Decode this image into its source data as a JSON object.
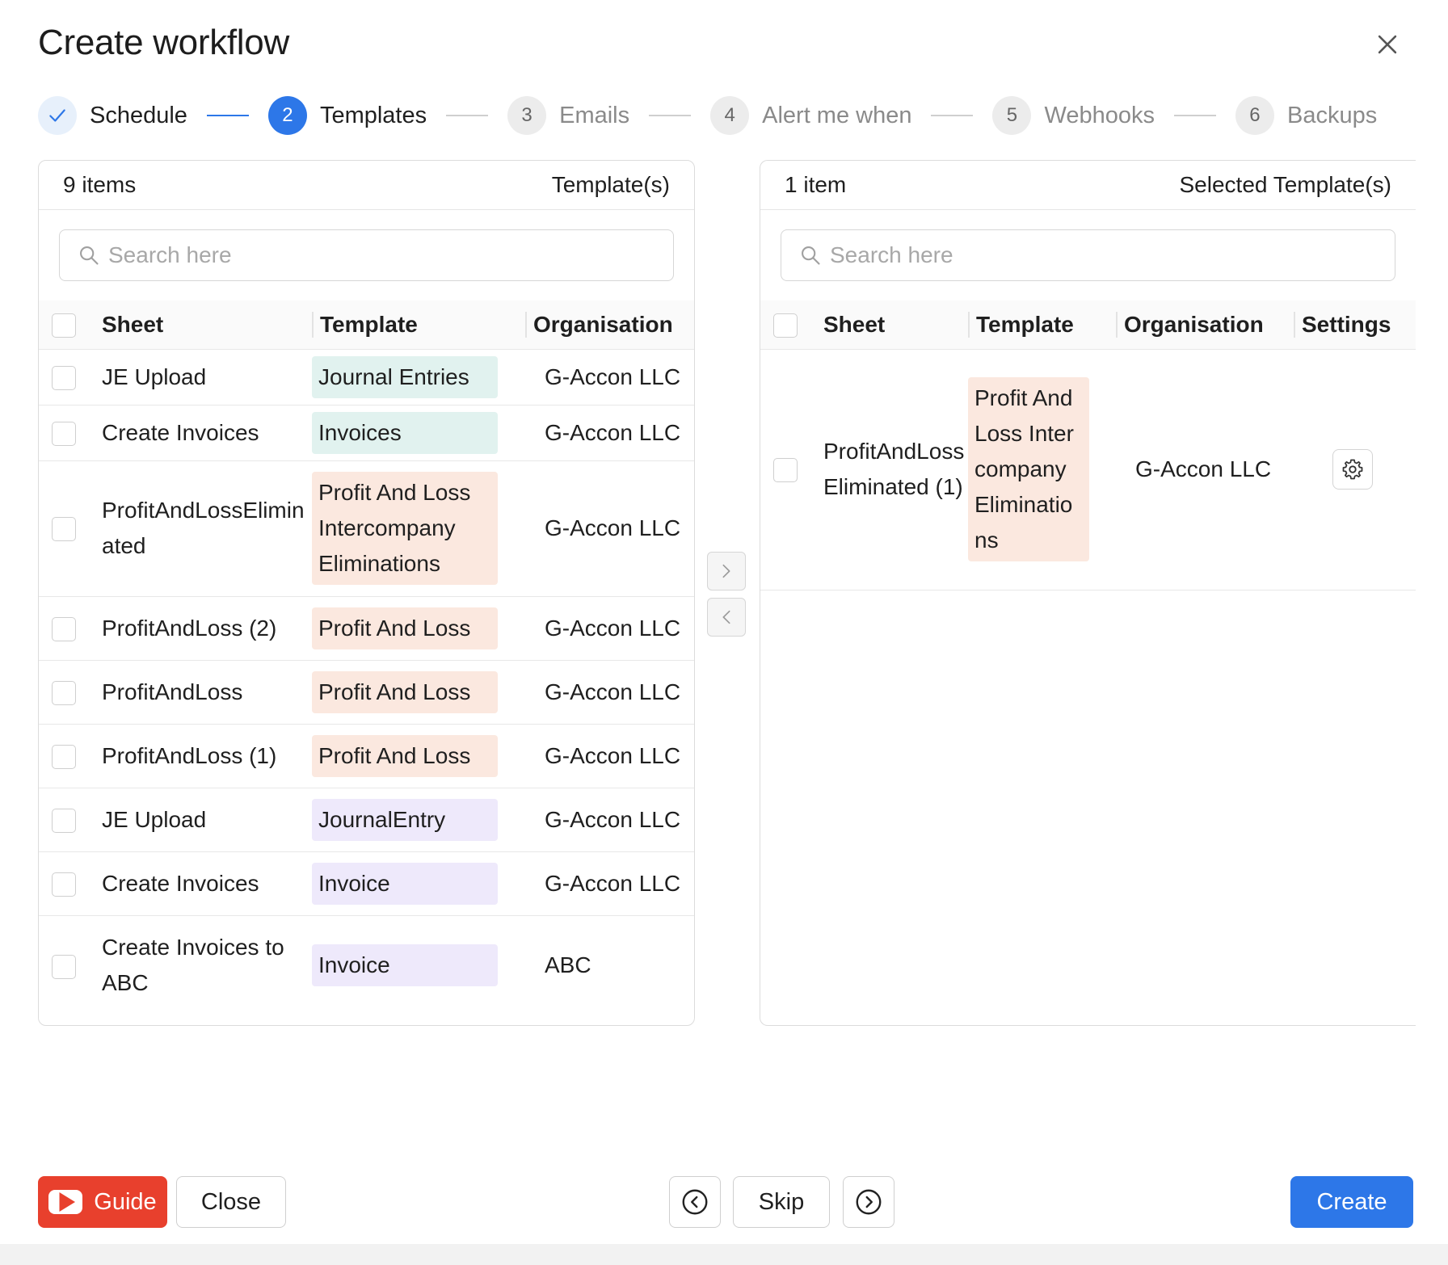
{
  "dialog": {
    "title": "Create workflow"
  },
  "stepper": [
    {
      "number": "",
      "label": "Schedule",
      "state": "done"
    },
    {
      "number": "2",
      "label": "Templates",
      "state": "active"
    },
    {
      "number": "3",
      "label": "Emails",
      "state": "pending"
    },
    {
      "number": "4",
      "label": "Alert me when",
      "state": "pending"
    },
    {
      "number": "5",
      "label": "Webhooks",
      "state": "pending"
    },
    {
      "number": "6",
      "label": "Backups",
      "state": "pending"
    }
  ],
  "left_panel": {
    "count": "9 items",
    "title": "Template(s)",
    "search_placeholder": "Search here",
    "columns": {
      "sheet": "Sheet",
      "template": "Template",
      "organisation": "Organisation"
    },
    "rows": [
      {
        "sheet": "JE Upload",
        "template": "Journal Entries",
        "template_color": "teal",
        "organisation": "G-Accon LLC"
      },
      {
        "sheet": "Create Invoices",
        "template": "Invoices",
        "template_color": "teal",
        "organisation": "G-Accon LLC"
      },
      {
        "sheet": "ProfitAndLossEliminated",
        "template": "Profit And Loss Intercompany Eliminations",
        "template_color": "peach",
        "organisation": "G-Accon LLC"
      },
      {
        "sheet": "ProfitAndLoss (2)",
        "template": "Profit And Loss",
        "template_color": "peach",
        "organisation": "G-Accon LLC"
      },
      {
        "sheet": "ProfitAndLoss",
        "template": "Profit And Loss",
        "template_color": "peach",
        "organisation": "G-Accon LLC"
      },
      {
        "sheet": "ProfitAndLoss (1)",
        "template": "Profit And Loss",
        "template_color": "peach",
        "organisation": "G-Accon LLC"
      },
      {
        "sheet": "JE Upload",
        "template": "JournalEntry",
        "template_color": "lavender",
        "organisation": "G-Accon LLC"
      },
      {
        "sheet": "Create Invoices",
        "template": "Invoice",
        "template_color": "lavender",
        "organisation": "G-Accon LLC"
      },
      {
        "sheet": "Create Invoices to ABC",
        "template": "Invoice",
        "template_color": "lavender",
        "organisation": "ABC"
      }
    ]
  },
  "right_panel": {
    "count": "1 item",
    "title": "Selected Template(s)",
    "search_placeholder": "Search here",
    "columns": {
      "sheet": "Sheet",
      "template": "Template",
      "organisation": "Organisation",
      "settings": "Settings"
    },
    "rows": [
      {
        "sheet": "ProfitAndLossEliminated (1)",
        "template": "Profit And Loss Intercompany Eliminations",
        "template_color": "peach",
        "organisation": "G-Accon LLC",
        "settings_icon": "gear-icon"
      }
    ]
  },
  "footer": {
    "guide_label": "Guide",
    "close_label": "Close",
    "skip_label": "Skip",
    "create_label": "Create"
  },
  "colors": {
    "primary": "#2d77e8",
    "guide_red": "#e8402d",
    "tag_teal": "#e1f2ef",
    "tag_peach": "#fbe8df",
    "tag_lavender": "#eee9fb"
  }
}
